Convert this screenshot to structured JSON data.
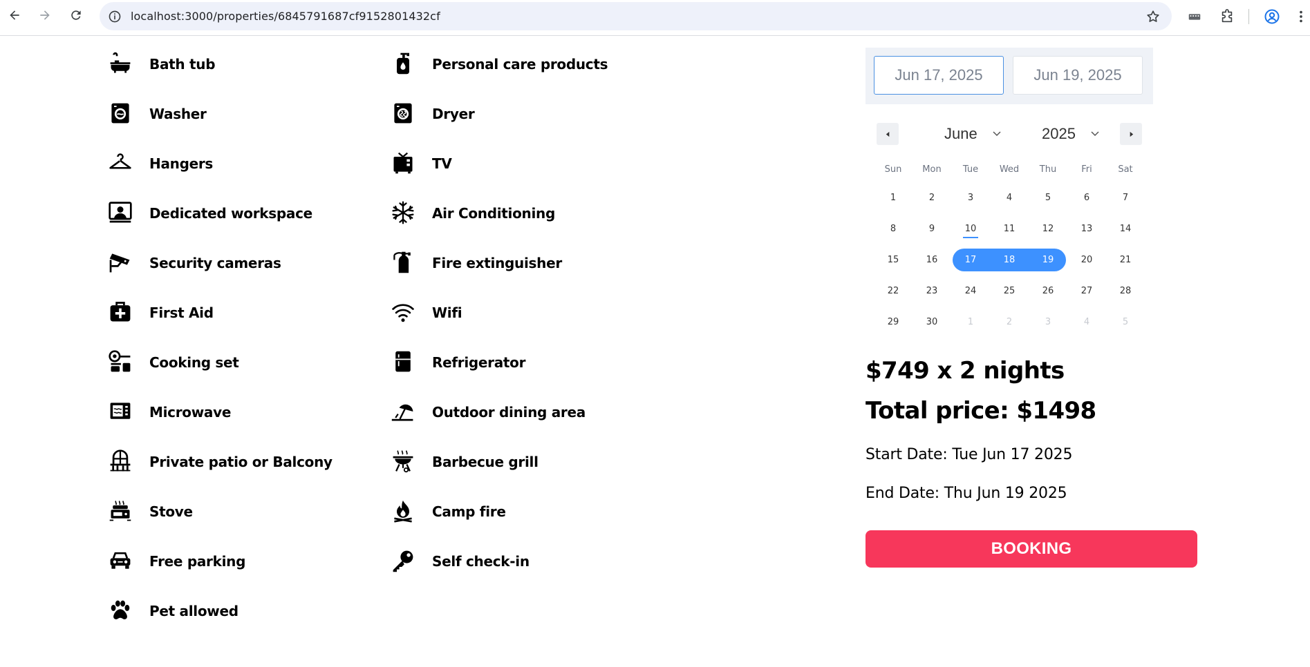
{
  "browser": {
    "url": "localhost:3000/properties/6845791687cf9152801432cf"
  },
  "amenities": {
    "left": [
      {
        "label": "Bath tub",
        "icon": "bathtub-icon"
      },
      {
        "label": "Washer",
        "icon": "washer-icon"
      },
      {
        "label": "Hangers",
        "icon": "hanger-icon"
      },
      {
        "label": "Dedicated workspace",
        "icon": "workspace-icon"
      },
      {
        "label": "Security cameras",
        "icon": "security-camera-icon"
      },
      {
        "label": "First Aid",
        "icon": "first-aid-icon"
      },
      {
        "label": "Cooking set",
        "icon": "cooking-set-icon"
      },
      {
        "label": "Microwave",
        "icon": "microwave-icon"
      },
      {
        "label": "Private patio or Balcony",
        "icon": "balcony-icon"
      },
      {
        "label": "Stove",
        "icon": "stove-icon"
      },
      {
        "label": "Free parking",
        "icon": "car-icon"
      },
      {
        "label": "Pet allowed",
        "icon": "paw-icon"
      }
    ],
    "right": [
      {
        "label": "Personal care products",
        "icon": "soap-bottle-icon"
      },
      {
        "label": "Dryer",
        "icon": "dryer-icon"
      },
      {
        "label": "TV",
        "icon": "tv-icon"
      },
      {
        "label": "Air Conditioning",
        "icon": "snowflake-icon"
      },
      {
        "label": "Fire extinguisher",
        "icon": "fire-extinguisher-icon"
      },
      {
        "label": "Wifi",
        "icon": "wifi-icon"
      },
      {
        "label": "Refrigerator",
        "icon": "refrigerator-icon"
      },
      {
        "label": "Outdoor dining area",
        "icon": "umbrella-icon"
      },
      {
        "label": "Barbecue grill",
        "icon": "grill-icon"
      },
      {
        "label": "Camp fire",
        "icon": "campfire-icon"
      },
      {
        "label": "Self check-in",
        "icon": "key-icon"
      }
    ]
  },
  "date_range": {
    "start": "Jun 17, 2025",
    "end": "Jun 19, 2025"
  },
  "calendar": {
    "month": "June",
    "year": "2025",
    "weekdays": [
      "Sun",
      "Mon",
      "Tue",
      "Wed",
      "Thu",
      "Fri",
      "Sat"
    ],
    "weeks": [
      [
        "1",
        "2",
        "3",
        "4",
        "5",
        "6",
        "7"
      ],
      [
        "8",
        "9",
        "10",
        "11",
        "12",
        "13",
        "14"
      ],
      [
        "15",
        "16",
        "17",
        "18",
        "19",
        "20",
        "21"
      ],
      [
        "22",
        "23",
        "24",
        "25",
        "26",
        "27",
        "28"
      ],
      [
        "29",
        "30",
        "1",
        "2",
        "3",
        "4",
        "5"
      ]
    ],
    "today": "10",
    "selected": [
      "17",
      "18",
      "19"
    ],
    "accent_color": "#3d91ff"
  },
  "pricing": {
    "nightly": "$749 x 2 nights",
    "total": "Total price: $1498",
    "start_date": "Start Date: Tue Jun 17 2025",
    "end_date": "End Date: Thu Jun 19 2025",
    "booking_label": "BOOKING",
    "booking_color": "#f7375b"
  }
}
